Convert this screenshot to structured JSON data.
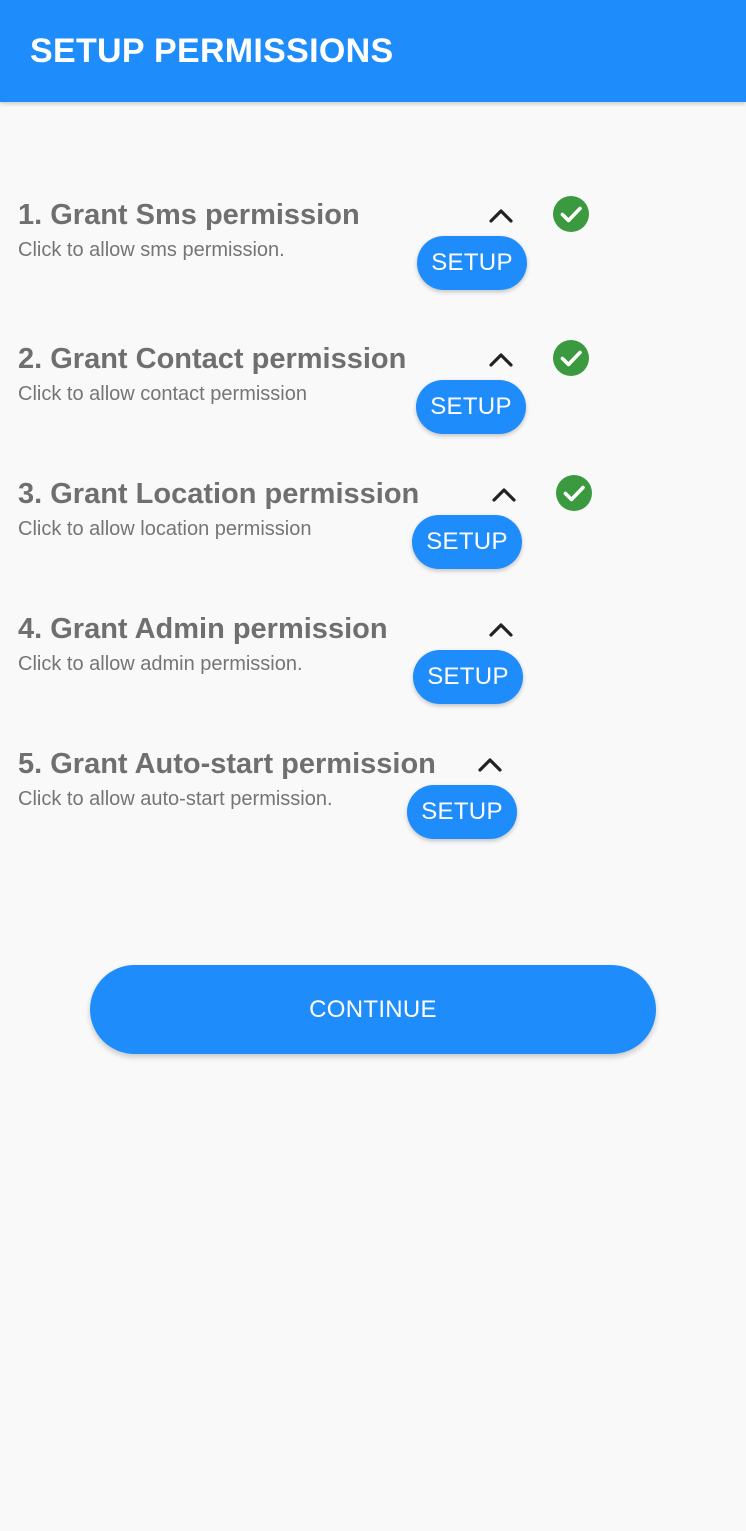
{
  "appbar": {
    "title": "SETUP PERMISSIONS",
    "color": "#1e8cfb"
  },
  "permissions": [
    {
      "title": "1. Grant Sms permission",
      "description": "Click to allow sms permission.",
      "button_label": "SETUP",
      "expand_icon": "chevron-up-icon",
      "granted": true
    },
    {
      "title": "2. Grant Contact permission",
      "description": "Click to allow contact permission",
      "button_label": "SETUP",
      "expand_icon": "chevron-up-icon",
      "granted": true
    },
    {
      "title": "3. Grant Location permission",
      "description": "Click to allow location permission",
      "button_label": "SETUP",
      "expand_icon": "chevron-up-icon",
      "granted": true
    },
    {
      "title": "4. Grant Admin permission",
      "description": "Click to allow admin permission.",
      "button_label": "SETUP",
      "expand_icon": "chevron-up-icon",
      "granted": false
    },
    {
      "title": "5. Grant Auto-start permission",
      "description": "Click to allow auto-start permission.",
      "button_label": "SETUP",
      "expand_icon": "chevron-up-icon",
      "granted": false
    }
  ],
  "granted_icon": "check-circle-icon",
  "granted_color": "#3b9a3f",
  "continue_label": "CONTINUE"
}
